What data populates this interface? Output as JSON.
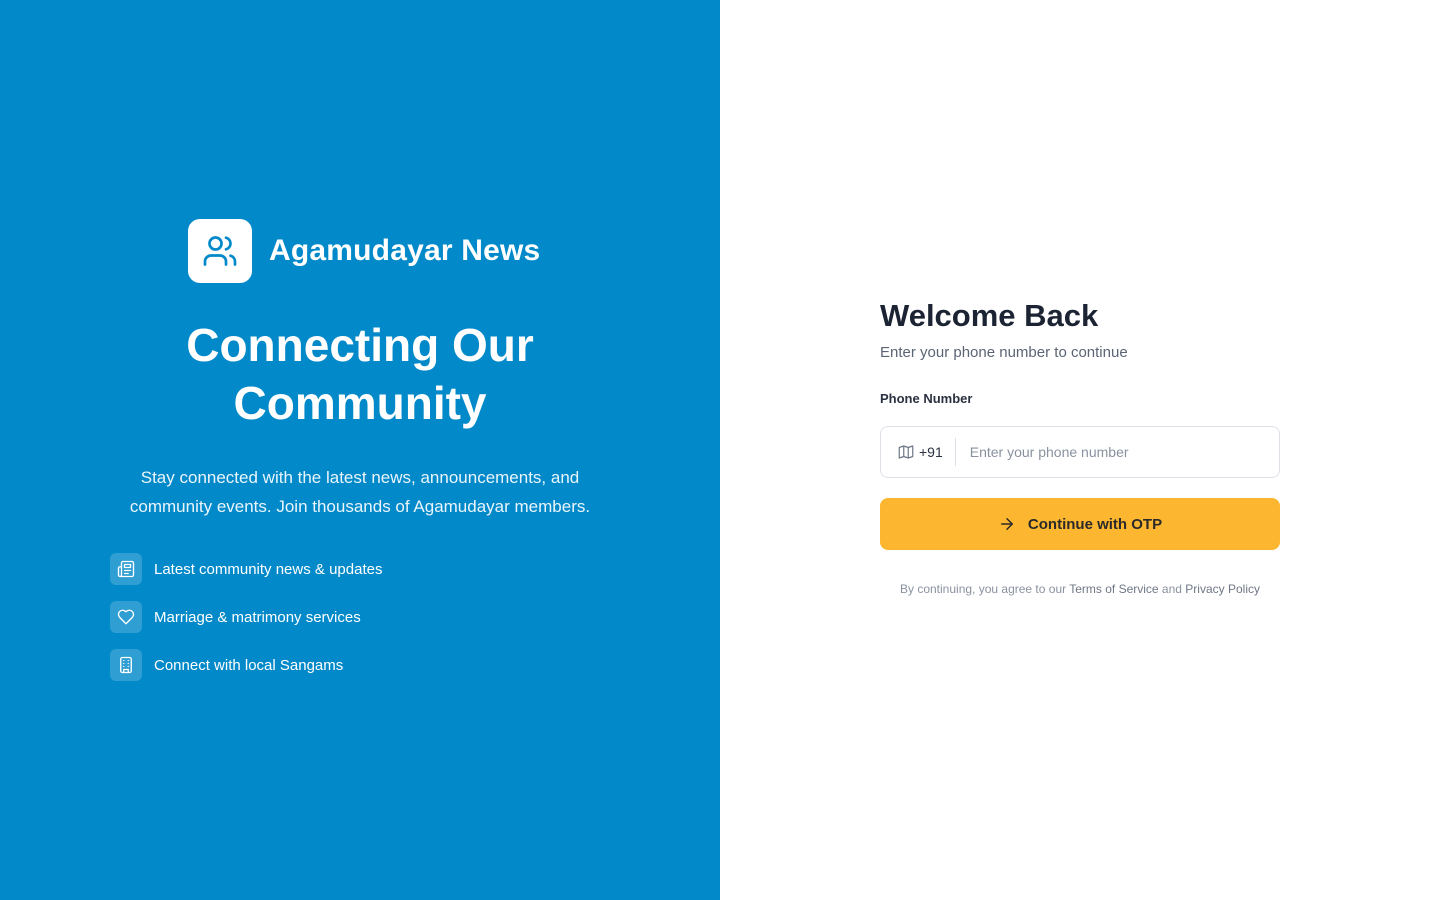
{
  "brand": {
    "name": "Agamudayar News"
  },
  "hero": {
    "headline_line1": "Connecting Our",
    "headline_line2": "Community",
    "tagline": "Stay connected with the latest news, announcements, and community events. Join thousands of Agamudayar members."
  },
  "features": [
    {
      "icon": "newspaper-icon",
      "label": "Latest community news & updates"
    },
    {
      "icon": "heart-icon",
      "label": "Marriage & matrimony services"
    },
    {
      "icon": "building-icon",
      "label": "Connect with local Sangams"
    }
  ],
  "login": {
    "title": "Welcome Back",
    "subtitle": "Enter your phone number to continue",
    "phone_label": "Phone Number",
    "country_code": "+91",
    "phone_value": "",
    "phone_placeholder": "Enter your phone number",
    "button_label": "Continue with OTP",
    "terms_prefix": "By continuing, you agree to our ",
    "terms_link": "Terms of Service",
    "terms_and": " and ",
    "privacy_link": "Privacy Policy"
  },
  "colors": {
    "panel_blue": "#0289c9",
    "button_yellow": "#fdb62f",
    "title_dark": "#1c2333"
  }
}
